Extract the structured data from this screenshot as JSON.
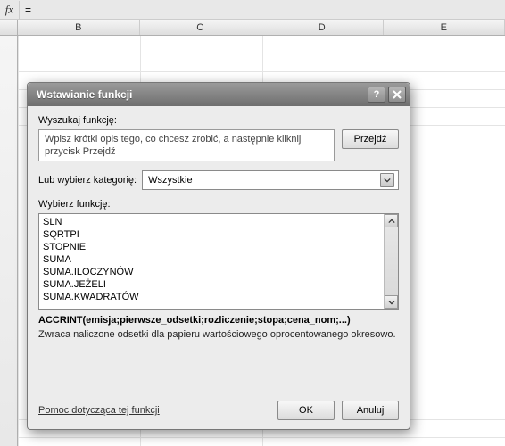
{
  "formula_bar": {
    "value": "="
  },
  "columns": [
    "B",
    "C",
    "D",
    "E"
  ],
  "dialog": {
    "title": "Wstawianie funkcji",
    "search_label": "Wyszukaj funkcję:",
    "search_text": "Wpisz krótki opis tego, co chcesz zrobić, a następnie kliknij przycisk Przejdź",
    "go_button": "Przejdź",
    "category_label": "Lub wybierz kategorię:",
    "category_value": "Wszystkie",
    "select_fn_label": "Wybierz funkcję:",
    "functions": [
      "SLN",
      "SQRTPI",
      "STOPNIE",
      "SUMA",
      "SUMA.ILOCZYNÓW",
      "SUMA.JEŻELI",
      "SUMA.KWADRATÓW"
    ],
    "signature": "ACCRINT(emisja;pierwsze_odsetki;rozliczenie;stopa;cena_nom;...)",
    "description": "Zwraca naliczone odsetki dla papieru wartościowego oprocentowanego okresowo.",
    "help_link": "Pomoc dotycząca tej funkcji",
    "ok": "OK",
    "cancel": "Anuluj"
  }
}
